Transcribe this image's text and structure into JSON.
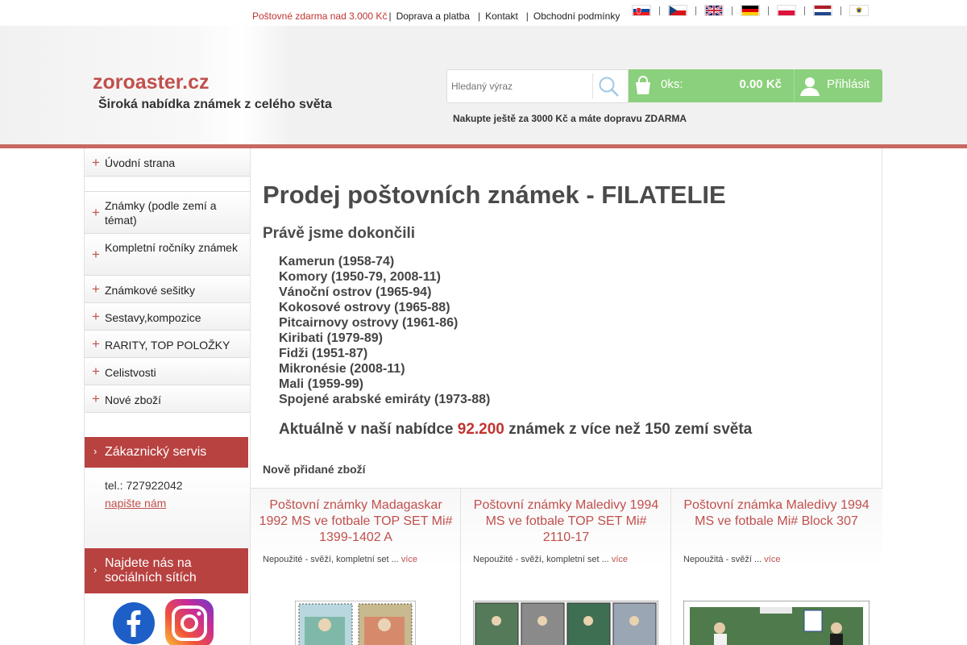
{
  "topbar": {
    "promo": "Poštovné zdarma nad 3.000 Kč",
    "links": [
      "Doprava a platba",
      "Kontakt",
      "Obchodní podmínky"
    ],
    "flags": [
      "flag-slovakia-icon",
      "flag-czech-icon",
      "flag-uk-icon",
      "flag-germany-icon",
      "flag-poland-icon",
      "flag-netherlands-icon",
      "flag-virgin-islands-icon"
    ]
  },
  "header": {
    "logo": "zoroaster.cz",
    "tagline": "Široká nabídka známek z celého světa",
    "search_placeholder": "Hledaný výraz",
    "cart_count": "0ks:",
    "cart_price": "0.00 Kč",
    "login": "Přihlásit",
    "shipping_note": "Nakupte ještě za 3000 Kč a máte dopravu ZDARMA"
  },
  "sidebar": {
    "menu": [
      "Úvodní strana",
      "Známky (podle zemí a témat)",
      "Kompletní ročníky známek",
      "Známkové sešitky",
      "Sestavy,kompozice",
      "RARITY, TOP POLOŽKY",
      "Celistvosti",
      "Nové zboží"
    ],
    "service_title": "Zákaznický servis",
    "phone": "tel.: 727922042",
    "write_us": "napište nám",
    "social_title": "Najdete nás na sociálních sítích"
  },
  "main": {
    "title": "Prodej poštovních známek - FILATELIE",
    "subtitle": "Právě jsme dokončili",
    "countries": [
      "Kamerun (1958-74)",
      "Komory (1950-79, 2008-11)",
      "Vánoční ostrov (1965-94)",
      "Kokosové ostrovy (1965-88)",
      "Pitcairnovy ostrovy (1961-86)",
      "Kiribati (1979-89)",
      "Fidži (1951-87)",
      "Mikronésie (2008-11)",
      "Mali (1959-99)",
      "Spojené arabské emiráty (1973-88)"
    ],
    "offer_before": "Aktuálně v naší nabídce",
    "offer_number": "92.200",
    "offer_after": "známek z více než 150 zemí světa",
    "new_items": "Nově přidané zboží",
    "products": [
      {
        "title": "Poštovní známky Madagaskar 1992 MS ve fotbale TOP SET Mi# 1399-1402 A",
        "desc": "Nepoužité - svěží, kompletní set ...",
        "more": "více"
      },
      {
        "title": "Poštovní známky Maledivy 1994 MS ve fotbale TOP SET Mi# 2110-17",
        "desc": "Nepoužité - svěží, kompletní set ...",
        "more": "více"
      },
      {
        "title": "Poštovní známka Maledivy 1994 MS ve fotbale Mi# Block 307",
        "desc": "Nepoužitá - svěží ...",
        "more": "více"
      }
    ]
  },
  "colors": {
    "accent": "#c0504d",
    "panel": "#b84240",
    "cart": "#8bd07c",
    "promo": "#c0342f"
  }
}
